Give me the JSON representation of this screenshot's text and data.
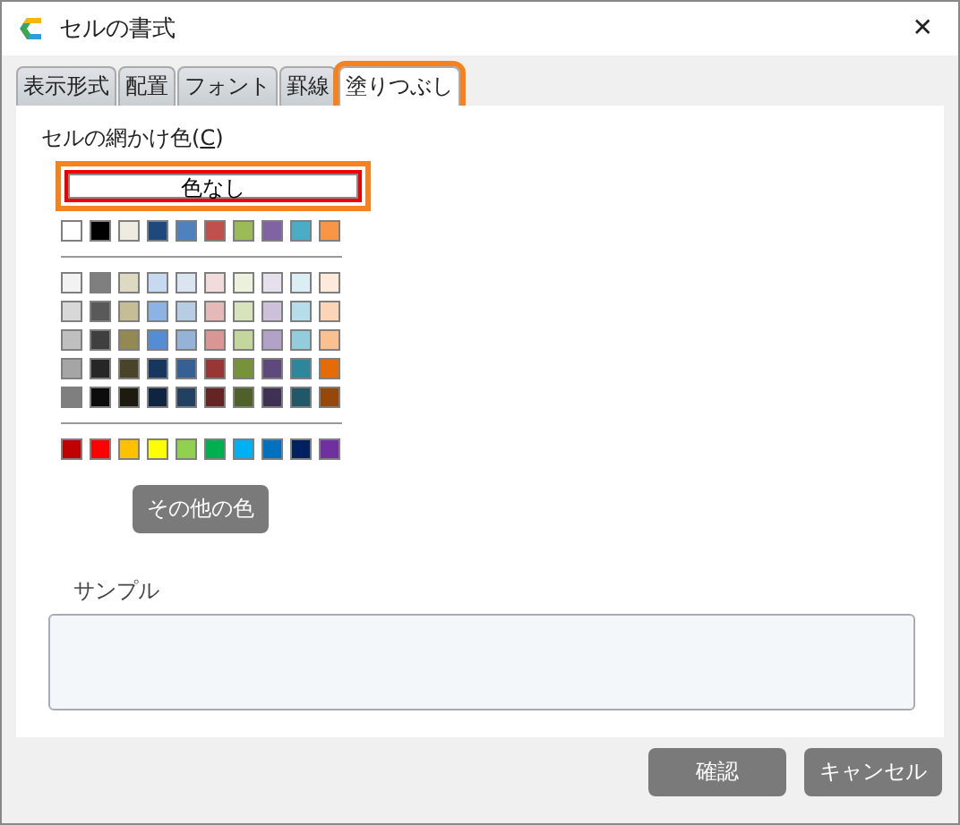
{
  "window": {
    "title": "セルの書式",
    "close": "✕"
  },
  "tabs": [
    {
      "label": "表示形式",
      "selected": false,
      "highlighted": false
    },
    {
      "label": "配置",
      "selected": false,
      "highlighted": false
    },
    {
      "label": "フォント",
      "selected": false,
      "highlighted": false
    },
    {
      "label": "罫線",
      "selected": false,
      "highlighted": false
    },
    {
      "label": "塗りつぶし",
      "selected": true,
      "highlighted": true
    }
  ],
  "shading": {
    "label_before": "セルの網かけ色(",
    "accesskey": "C",
    "label_after": ")",
    "no_color": {
      "label": "色なし",
      "selected": true,
      "highlighted": true
    },
    "theme_row": [
      {
        "color": "#ffffff"
      },
      {
        "color": "#000000"
      },
      {
        "color": "#eeece1"
      },
      {
        "color": "#1f497d"
      },
      {
        "color": "#4f81bd"
      },
      {
        "color": "#c0504d"
      },
      {
        "color": "#9bbb59"
      },
      {
        "color": "#8064a2"
      },
      {
        "color": "#4bacc6"
      },
      {
        "color": "#f79646"
      }
    ],
    "shade_rows": [
      [
        {
          "color": "#f2f2f2"
        },
        {
          "color": "#7f7f7f"
        },
        {
          "color": "#ddd9c3"
        },
        {
          "color": "#c6d9f0"
        },
        {
          "color": "#dbe5f1"
        },
        {
          "color": "#f2dcdb"
        },
        {
          "color": "#ebf1dd"
        },
        {
          "color": "#e5e0ec"
        },
        {
          "color": "#dbeef3"
        },
        {
          "color": "#fdeada"
        }
      ],
      [
        {
          "color": "#d8d8d8"
        },
        {
          "color": "#595959"
        },
        {
          "color": "#c4bd97"
        },
        {
          "color": "#8db3e2"
        },
        {
          "color": "#b8cce4"
        },
        {
          "color": "#e5b9b7"
        },
        {
          "color": "#d7e3bc"
        },
        {
          "color": "#ccc1d9"
        },
        {
          "color": "#b7dde8"
        },
        {
          "color": "#fbd5b5"
        }
      ],
      [
        {
          "color": "#bfbfbf"
        },
        {
          "color": "#3f3f3f"
        },
        {
          "color": "#938953"
        },
        {
          "color": "#548dd4"
        },
        {
          "color": "#95b3d7"
        },
        {
          "color": "#d99694"
        },
        {
          "color": "#c3d69b"
        },
        {
          "color": "#b2a2c7"
        },
        {
          "color": "#92cddc"
        },
        {
          "color": "#fac08f"
        }
      ],
      [
        {
          "color": "#a5a5a5"
        },
        {
          "color": "#262626"
        },
        {
          "color": "#494429"
        },
        {
          "color": "#17365d"
        },
        {
          "color": "#366092"
        },
        {
          "color": "#953734"
        },
        {
          "color": "#76923c"
        },
        {
          "color": "#5f497a"
        },
        {
          "color": "#31859b"
        },
        {
          "color": "#e36c09"
        }
      ],
      [
        {
          "color": "#7f7f7f"
        },
        {
          "color": "#0c0c0c"
        },
        {
          "color": "#1d1b10"
        },
        {
          "color": "#0f243e"
        },
        {
          "color": "#244061"
        },
        {
          "color": "#632423"
        },
        {
          "color": "#4f6128"
        },
        {
          "color": "#3f3151"
        },
        {
          "color": "#205867"
        },
        {
          "color": "#974806"
        }
      ]
    ],
    "standard_row": [
      {
        "color": "#c00000"
      },
      {
        "color": "#ff0000"
      },
      {
        "color": "#ffc000"
      },
      {
        "color": "#ffff00"
      },
      {
        "color": "#92d050"
      },
      {
        "color": "#00b050"
      },
      {
        "color": "#00b0f0"
      },
      {
        "color": "#0070c0"
      },
      {
        "color": "#002060"
      },
      {
        "color": "#7030a0"
      }
    ],
    "more_colors": "その他の色"
  },
  "sample": {
    "label": "サンプル"
  },
  "buttons": [
    "確認",
    "キャンセル"
  ]
}
